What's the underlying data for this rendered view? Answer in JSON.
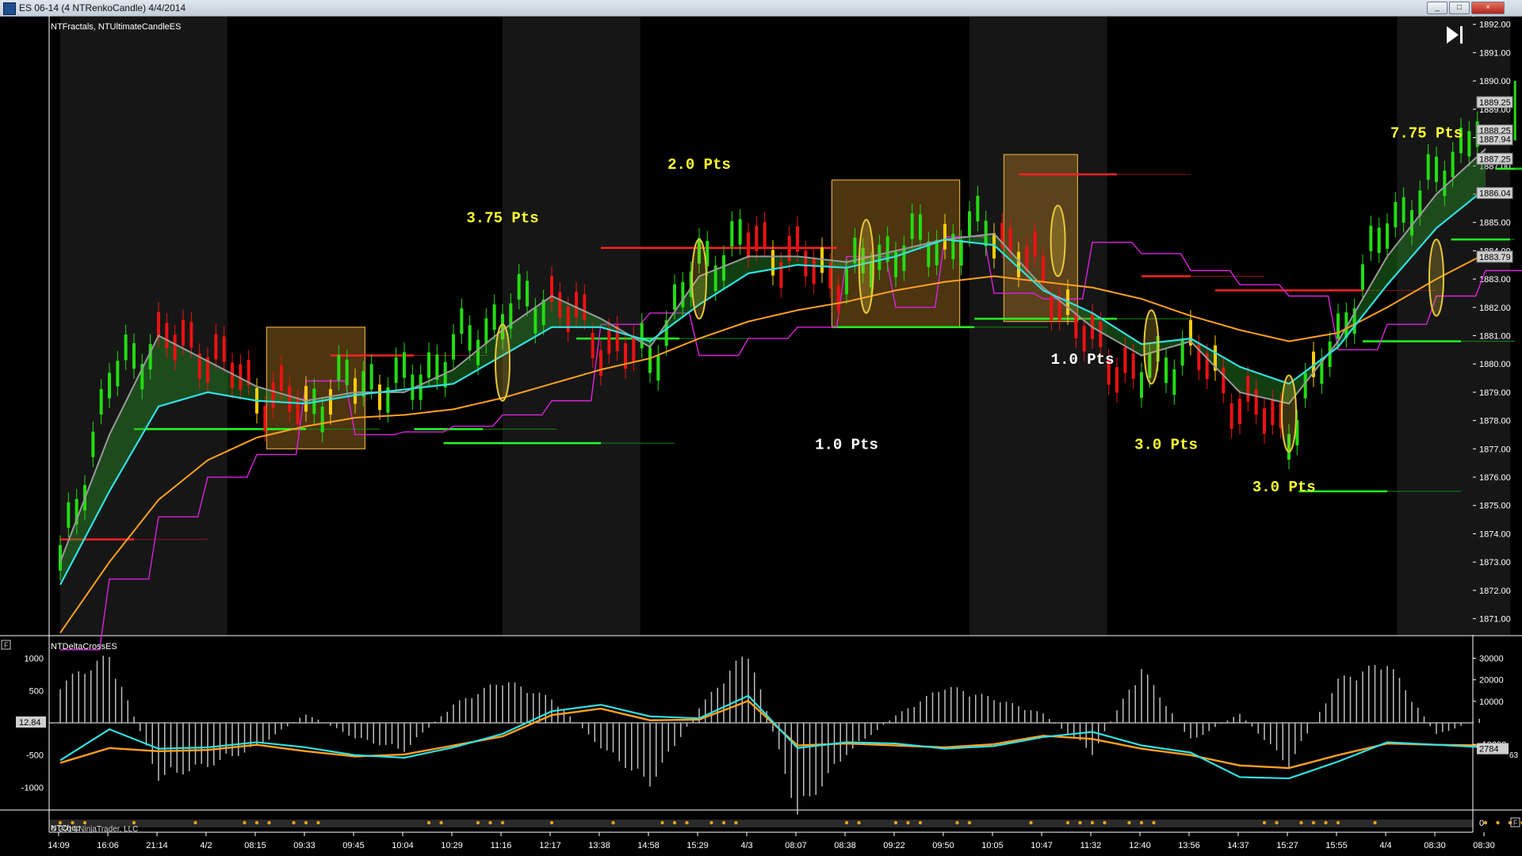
{
  "window": {
    "title": "ES 06-14 (4 NTRenkoCandle)  4/4/2014",
    "buttons": [
      "_",
      "□",
      "×"
    ]
  },
  "colors": {
    "background": "#000000",
    "up_bar": "#22dd11",
    "down_bar": "#ee1111",
    "neutral_bar": "#ffcc00",
    "cyan_ma": "#33e0e0",
    "orange_ma": "#ffa020",
    "gray_ma": "#9a9a9a",
    "magenta_stop": "#dd22dd",
    "annotation_yellow": "#ffff33",
    "annotation_white": "#ffffff"
  },
  "price_panel": {
    "indicator_label": "NTFractals, NTUltimateCandleES",
    "play_icon": "skip-to-end-icon",
    "price_ticks": [
      "1892.00",
      "1891.00",
      "1890.00",
      "1889.00",
      "1888.00",
      "1887.00",
      "1886.00",
      "1885.00",
      "1884.00",
      "1883.00",
      "1882.00",
      "1881.00",
      "1880.00",
      "1879.00",
      "1878.00",
      "1877.00",
      "1876.00",
      "1875.00",
      "1874.00",
      "1873.00",
      "1872.00",
      "1871.00"
    ],
    "price_markers": [
      {
        "label": "1889.25",
        "value": 1889.25
      },
      {
        "label": "1888.25",
        "value": 1888.25
      },
      {
        "label": "1887.94",
        "value": 1887.94
      },
      {
        "label": "1887.25",
        "value": 1887.25
      },
      {
        "label": "1886.04",
        "value": 1886.04
      },
      {
        "label": "1883.79",
        "value": 1883.79
      }
    ],
    "annotations": [
      {
        "text": "3.75  Pts",
        "color": "yellow",
        "bar_index": 9,
        "price": 1885.0
      },
      {
        "text": "2.0  Pts",
        "color": "yellow",
        "bar_index": 13,
        "price": 1886.9
      },
      {
        "text": "1.0  Pts",
        "color": "white",
        "bar_index": 16,
        "price": 1877.0
      },
      {
        "text": "1.0  Pts",
        "color": "white",
        "bar_index": 20.8,
        "price": 1880.0
      },
      {
        "text": "3.0  Pts",
        "color": "yellow",
        "bar_index": 22.5,
        "price": 1877.0
      },
      {
        "text": "3.0  Pts",
        "color": "yellow",
        "bar_index": 24.9,
        "price": 1875.5
      },
      {
        "text": "7.75  Pts",
        "color": "yellow",
        "bar_index": 27.8,
        "price": 1888.0
      }
    ]
  },
  "lower_panel": {
    "indicator_label": "NTDeltaCrossES",
    "left_ticks": [
      "1000",
      "500",
      "-500",
      "-1000"
    ],
    "left_marker": "12.84",
    "right_ticks": [
      "30000",
      "20000",
      "10000",
      "-10000"
    ],
    "right_marker": "2784",
    "right_marker_tail": "63"
  },
  "footer_panel": {
    "indicator_label": "NTChop",
    "right_tick": "0",
    "copyright": "© 2014 NinjaTrader, LLC"
  },
  "x_axis": {
    "labels": [
      "14:09",
      "16:06",
      "21:14",
      "4/2",
      "08:15",
      "09:33",
      "09:45",
      "10:04",
      "10:29",
      "11:16",
      "12:17",
      "13:38",
      "14:58",
      "15:29",
      "4/3",
      "08:07",
      "08:38",
      "09:22",
      "09:50",
      "10:05",
      "10:47",
      "11:32",
      "12:40",
      "13:56",
      "14:37",
      "15:27",
      "15:55",
      "4/4",
      "08:30",
      "08:30"
    ]
  },
  "chart_data": [
    {
      "type": "candlestick-renko",
      "title": "ES 06-14 (4 NTRenkoCandle)",
      "x_categories": [
        "14:09",
        "16:06",
        "21:14",
        "4/2",
        "08:15",
        "09:33",
        "09:45",
        "10:04",
        "10:29",
        "11:16",
        "12:17",
        "13:38",
        "14:58",
        "15:29",
        "4/3",
        "08:07",
        "08:38",
        "09:22",
        "09:50",
        "10:05",
        "10:47",
        "11:32",
        "12:40",
        "13:56",
        "14:37",
        "15:27",
        "15:55",
        "4/4",
        "08:30",
        "08:30"
      ],
      "ylim": [
        1870.4,
        1892.3
      ],
      "series": [
        {
          "name": "price",
          "values": [
            1872.8,
            1879.4,
            1880.9,
            1880.5,
            1879.0,
            1878.5,
            1879.4,
            1879.2,
            1880.4,
            1881.7,
            1882.4,
            1880.8,
            1880.2,
            1883.5,
            1884.4,
            1883.7,
            1883.0,
            1884.1,
            1884.3,
            1884.8,
            1883.1,
            1880.7,
            1879.5,
            1880.6,
            1878.7,
            1877.7,
            1881.0,
            1884.9,
            1886.4,
            1889.0
          ]
        },
        {
          "name": "cyan_ma",
          "values": [
            1872.2,
            1875.5,
            1878.5,
            1879.0,
            1878.7,
            1878.6,
            1878.9,
            1879.1,
            1879.3,
            1880.3,
            1881.3,
            1881.3,
            1880.8,
            1882.1,
            1883.2,
            1883.5,
            1883.4,
            1883.8,
            1884.4,
            1884.2,
            1882.6,
            1881.8,
            1880.7,
            1880.9,
            1879.9,
            1879.3,
            1880.6,
            1882.8,
            1884.8,
            1886.2
          ]
        },
        {
          "name": "gray_ma",
          "values": [
            1873.0,
            1877.5,
            1881.0,
            1880.1,
            1879.2,
            1878.7,
            1879.0,
            1879.0,
            1879.8,
            1881.2,
            1882.4,
            1881.6,
            1880.6,
            1883.1,
            1883.8,
            1883.8,
            1883.6,
            1884.0,
            1884.4,
            1884.6,
            1882.7,
            1881.3,
            1880.3,
            1880.8,
            1879.0,
            1878.6,
            1880.8,
            1883.8,
            1886.0,
            1887.6
          ]
        },
        {
          "name": "orange_ma",
          "values": [
            1870.5,
            1873.0,
            1875.2,
            1876.6,
            1877.4,
            1877.8,
            1878.1,
            1878.2,
            1878.4,
            1878.8,
            1879.3,
            1879.8,
            1880.2,
            1880.9,
            1881.5,
            1881.9,
            1882.2,
            1882.6,
            1882.9,
            1883.1,
            1882.9,
            1882.7,
            1882.3,
            1881.7,
            1881.2,
            1880.8,
            1881.1,
            1882.0,
            1883.0,
            1883.9
          ]
        }
      ],
      "boxes": [
        {
          "from_bar": 4.2,
          "to_bar": 6.2,
          "low": 1877.0,
          "high": 1881.3
        },
        {
          "from_bar": 15.7,
          "to_bar": 18.3,
          "low": 1881.3,
          "high": 1886.5
        },
        {
          "from_bar": 19.2,
          "to_bar": 20.7,
          "low": 1881.5,
          "high": 1887.4
        }
      ],
      "resistance_lines": [
        {
          "from_bar": 0.0,
          "to_bar": 1.5,
          "price": 1873.8
        },
        {
          "from_bar": 5.5,
          "to_bar": 7.2,
          "price": 1880.3
        },
        {
          "from_bar": 11.0,
          "to_bar": 15.8,
          "price": 1884.1
        },
        {
          "from_bar": 19.5,
          "to_bar": 21.5,
          "price": 1886.7
        },
        {
          "from_bar": 22.0,
          "to_bar": 23.0,
          "price": 1883.1
        },
        {
          "from_bar": 23.5,
          "to_bar": 26.5,
          "price": 1882.6
        }
      ],
      "support_lines": [
        {
          "from_bar": 1.5,
          "to_bar": 5.0,
          "price": 1877.7
        },
        {
          "from_bar": 7.2,
          "to_bar": 8.6,
          "price": 1877.7
        },
        {
          "from_bar": 7.8,
          "to_bar": 11.0,
          "price": 1877.2
        },
        {
          "from_bar": 10.5,
          "to_bar": 12.6,
          "price": 1880.9
        },
        {
          "from_bar": 15.7,
          "to_bar": 18.6,
          "price": 1881.3
        },
        {
          "from_bar": 18.6,
          "to_bar": 21.5,
          "price": 1881.6
        },
        {
          "from_bar": 25.2,
          "to_bar": 27.0,
          "price": 1875.5
        },
        {
          "from_bar": 26.5,
          "to_bar": 28.5,
          "price": 1880.8
        },
        {
          "from_bar": 28.3,
          "to_bar": 29.5,
          "price": 1884.4
        },
        {
          "from_bar": 29.2,
          "to_bar": 30.0,
          "price": 1886.9
        }
      ],
      "markers": [
        {
          "bar": 9.0,
          "low": 1878.7,
          "high": 1881.4
        },
        {
          "bar": 13.0,
          "low": 1881.6,
          "high": 1884.4
        },
        {
          "bar": 16.4,
          "low": 1881.8,
          "high": 1885.1
        },
        {
          "bar": 20.3,
          "low": 1883.1,
          "high": 1885.6
        },
        {
          "bar": 22.2,
          "low": 1879.3,
          "high": 1881.9
        },
        {
          "bar": 25.0,
          "low": 1876.9,
          "high": 1879.6
        },
        {
          "bar": 28.0,
          "low": 1881.7,
          "high": 1884.4
        }
      ]
    },
    {
      "type": "bar",
      "title": "NTDeltaCrossES",
      "ylim": [
        -1350,
        1350
      ],
      "series": [
        {
          "name": "histogram",
          "values": [
            650,
            1100,
            -900,
            -700,
            -400,
            150,
            -250,
            -450,
            300,
            700,
            400,
            -400,
            -1000,
            250,
            1200,
            -1500,
            -500,
            120,
            600,
            400,
            150,
            -500,
            900,
            -300,
            150,
            -700,
            700,
            1000,
            -200,
            100
          ]
        },
        {
          "name": "cyan_line",
          "values": [
            -580,
            -100,
            -400,
            -380,
            -300,
            -380,
            -500,
            -540,
            -380,
            -170,
            180,
            280,
            100,
            70,
            420,
            -390,
            -300,
            -320,
            -400,
            -360,
            -220,
            -140,
            -350,
            -460,
            -840,
            -860,
            -600,
            -300,
            -340,
            -380
          ]
        },
        {
          "name": "orange_line",
          "values": [
            -620,
            -390,
            -440,
            -420,
            -340,
            -440,
            -520,
            -490,
            -350,
            -210,
            120,
            220,
            40,
            50,
            340,
            -350,
            -320,
            -350,
            -380,
            -330,
            -200,
            -250,
            -400,
            -500,
            -660,
            -700,
            -500,
            -320,
            -340,
            -350
          ]
        }
      ]
    }
  ]
}
